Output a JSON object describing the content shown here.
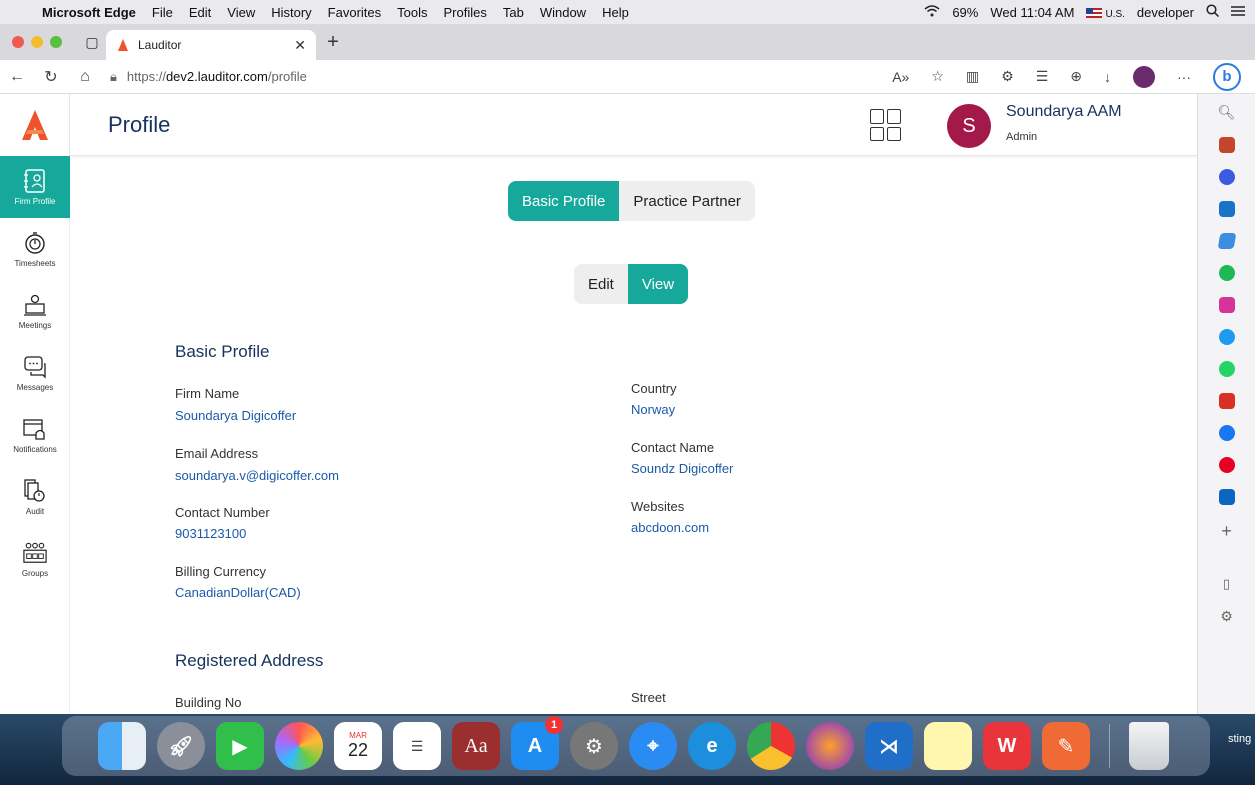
{
  "menubar": {
    "app_name": "Microsoft Edge",
    "items": [
      "File",
      "Edit",
      "View",
      "History",
      "Favorites",
      "Tools",
      "Profiles",
      "Tab",
      "Window",
      "Help"
    ],
    "battery": "69%",
    "clock": "Wed 11:04 AM",
    "input_source": "U.S.",
    "user": "developer"
  },
  "browser": {
    "tab_title": "Lauditor",
    "url_prefix": "https://",
    "url_host": "dev2.lauditor.com",
    "url_path": "/profile"
  },
  "sidebar": {
    "items": [
      {
        "label": "Firm Profile",
        "icon": "firm-profile-icon"
      },
      {
        "label": "Timesheets",
        "icon": "timer-icon"
      },
      {
        "label": "Meetings",
        "icon": "meeting-icon"
      },
      {
        "label": "Messages",
        "icon": "messages-icon"
      },
      {
        "label": "Notifications",
        "icon": "notifications-icon"
      },
      {
        "label": "Audit",
        "icon": "audit-icon"
      },
      {
        "label": "Groups",
        "icon": "groups-icon"
      }
    ]
  },
  "header": {
    "title": "Profile",
    "user_initial": "S",
    "user_name": "Soundarya AAM",
    "user_role": "Admin"
  },
  "toggles": {
    "basic_profile": "Basic Profile",
    "practice_partner": "Practice Partner",
    "edit": "Edit",
    "view": "View"
  },
  "basic_profile": {
    "title": "Basic Profile",
    "firm_name_label": "Firm Name",
    "firm_name": "Soundarya Digicoffer",
    "email_label": "Email Address",
    "email": "soundarya.v@digicoffer.com",
    "contact_number_label": "Contact Number",
    "contact_number": "9031123100",
    "billing_currency_label": "Billing Currency",
    "billing_currency": "CanadianDollar(CAD)",
    "country_label": "Country",
    "country": "Norway",
    "contact_name_label": "Contact Name",
    "contact_name": "Soundz Digicoffer",
    "websites_label": "Websites",
    "websites": "abcdoon.com"
  },
  "registered_address": {
    "title": "Registered Address",
    "building_no_label": "Building No",
    "street_label": "Street"
  },
  "dock": {
    "calendar_month": "MAR",
    "calendar_day": "22",
    "appstore_badge": "1",
    "desktop_text": "sting"
  },
  "colors": {
    "accent": "#16a99b",
    "title_blue": "#16325c",
    "link_blue": "#1b5aa8",
    "avatar": "#a31a4a"
  }
}
